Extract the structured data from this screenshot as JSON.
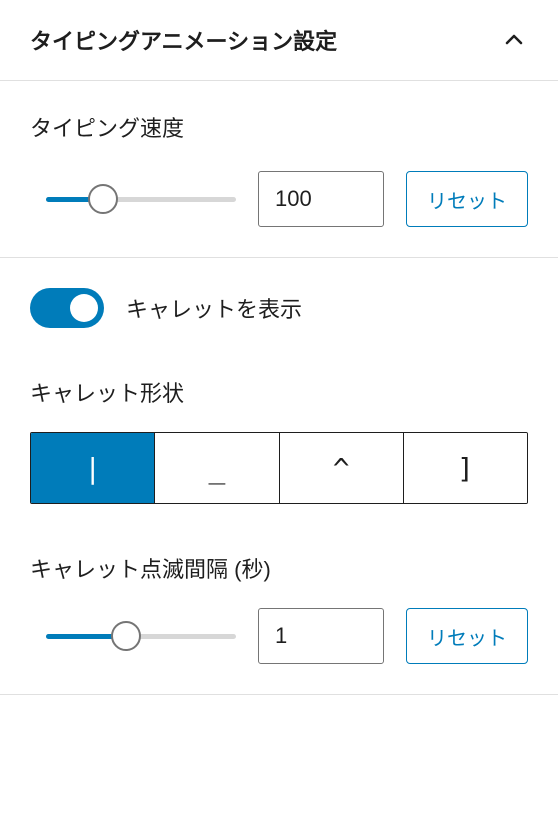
{
  "panel": {
    "title": "タイピングアニメーション設定"
  },
  "typing_speed": {
    "label": "タイピング速度",
    "value": "100",
    "slider_percent": 30,
    "reset_label": "リセット"
  },
  "caret_toggle": {
    "label": "キャレットを表示",
    "enabled": true
  },
  "caret_shape": {
    "label": "キャレット形状",
    "options": [
      "|",
      "_",
      "^",
      "]"
    ],
    "active_index": 0
  },
  "caret_blink": {
    "label": "キャレット点滅間隔 (秒)",
    "value": "1",
    "slider_percent": 42,
    "reset_label": "リセット"
  }
}
